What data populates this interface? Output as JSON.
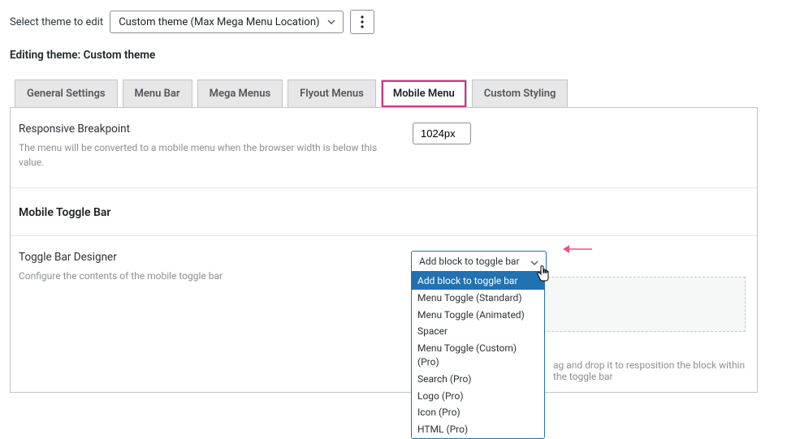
{
  "top": {
    "select_label": "Select theme to edit",
    "theme_options_selected": "Custom theme (Max Mega Menu Location)"
  },
  "editing": {
    "prefix": "Editing theme: ",
    "name": "Custom theme"
  },
  "tabs": [
    {
      "label": "General Settings"
    },
    {
      "label": "Menu Bar"
    },
    {
      "label": "Mega Menus"
    },
    {
      "label": "Flyout Menus"
    },
    {
      "label": "Mobile Menu"
    },
    {
      "label": "Custom Styling"
    }
  ],
  "active_tab_index": 4,
  "breakpoint": {
    "title": "Responsive Breakpoint",
    "desc": "The menu will be converted to a mobile menu when the browser width is below this value.",
    "value": "1024px"
  },
  "section": {
    "title": "Mobile Toggle Bar"
  },
  "designer": {
    "title": "Toggle Bar Designer",
    "desc": "Configure the contents of the mobile toggle bar",
    "placeholder": "Add block to toggle bar",
    "options": [
      "Add block to toggle bar",
      "Menu Toggle (Standard)",
      "Menu Toggle (Animated)",
      "Spacer",
      "Menu Toggle (Custom) (Pro)",
      "Search (Pro)",
      "Logo (Pro)",
      "Icon (Pro)",
      "HTML (Pro)"
    ],
    "drop_hint": "ag and drop it to resposition the block within the toggle bar"
  }
}
